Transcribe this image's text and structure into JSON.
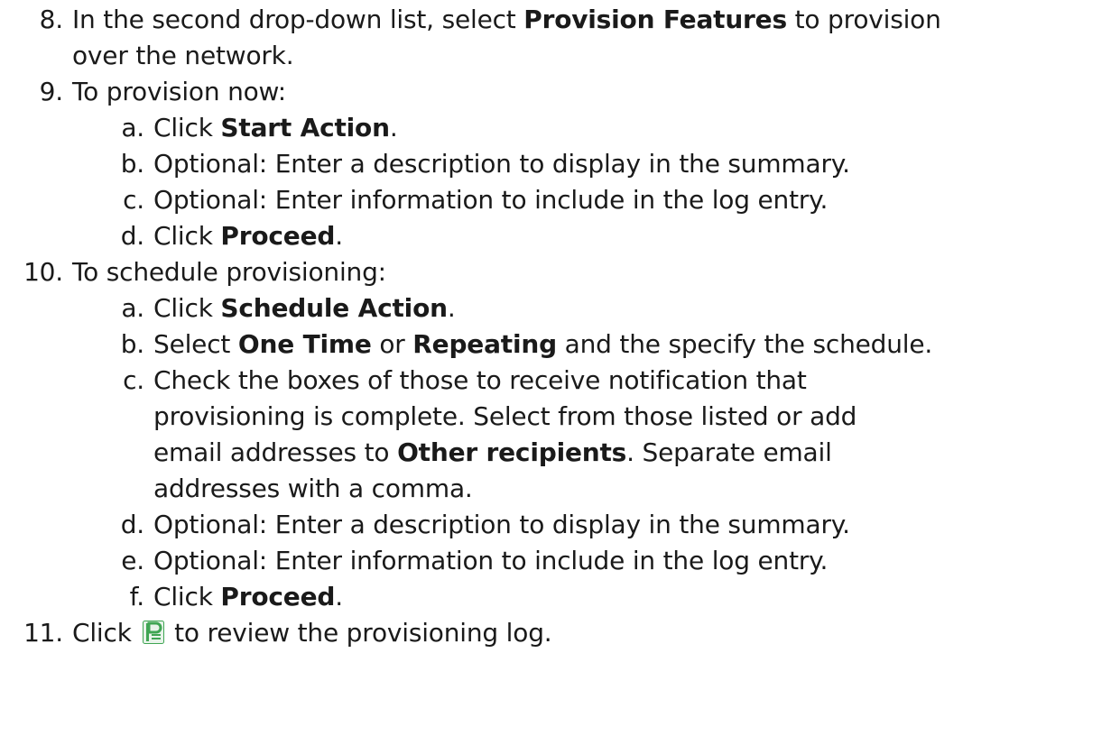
{
  "steps": {
    "s8": {
      "num": "8.",
      "l1_a": "In the second drop-down list, select ",
      "l1_b": "Provision Features",
      "l1_c": " to provision",
      "l2": "over the network."
    },
    "s9": {
      "num": "9.",
      "text": "To provision now:",
      "a": {
        "label": "a.",
        "pre": "Click ",
        "bold": "Start Action",
        "post": "."
      },
      "b": {
        "label": "b.",
        "text": "Optional: Enter a description to display in the summary."
      },
      "c": {
        "label": "c.",
        "text": "Optional: Enter information to include in the log entry."
      },
      "d": {
        "label": "d.",
        "pre": "Click ",
        "bold": "Proceed",
        "post": "."
      }
    },
    "s10": {
      "num": "10.",
      "text": "To schedule provisioning:",
      "a": {
        "label": "a.",
        "pre": "Click ",
        "bold": "Schedule Action",
        "post": "."
      },
      "b": {
        "label": "b.",
        "pre": "Select ",
        "bold1": "One Time",
        "mid": " or ",
        "bold2": "Repeating",
        "post": " and the specify the schedule."
      },
      "c": {
        "label": "c.",
        "l1": "Check the boxes of those to receive notification that",
        "l2": "provisioning is complete. Select from those listed or add",
        "l3_pre": "email addresses to ",
        "l3_bold": "Other recipients",
        "l3_post": ". Separate email",
        "l4": "addresses with a comma."
      },
      "d": {
        "label": "d.",
        "text": "Optional: Enter a description to display in the summary."
      },
      "e": {
        "label": "e.",
        "text": "Optional: Enter information to include in the log entry."
      },
      "f": {
        "label": "f.",
        "pre": "Click ",
        "bold": "Proceed",
        "post": "."
      }
    },
    "s11": {
      "num": "11.",
      "pre": "Click ",
      "icon": "provisioning-log-icon",
      "post": " to review the provisioning log."
    }
  },
  "colors": {
    "text": "#1a1a1a",
    "icon_green": "#3fa553",
    "icon_bg": "#e8f3ea"
  }
}
